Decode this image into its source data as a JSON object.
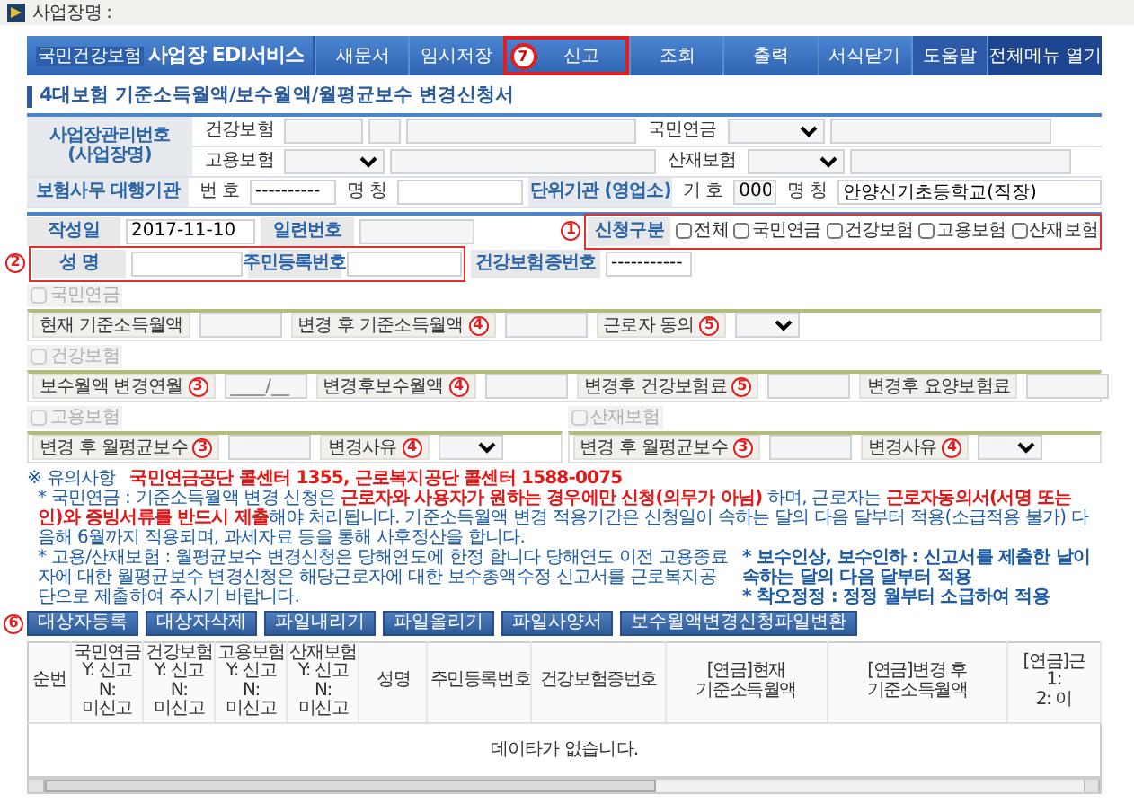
{
  "window": {
    "title": "사업장명 :"
  },
  "menu": {
    "logo": "국민건강보험",
    "service": "사업장 EDI서비스",
    "items": [
      {
        "label": "새문서",
        "kind": "main",
        "highlighted": false
      },
      {
        "label": "임시저장",
        "kind": "main",
        "highlighted": false
      },
      {
        "label": "신고",
        "kind": "main",
        "highlighted": true,
        "marker": "7"
      },
      {
        "label": "조회",
        "kind": "main",
        "highlighted": false
      },
      {
        "label": "출력",
        "kind": "main",
        "highlighted": false
      },
      {
        "label": "서식닫기",
        "kind": "main",
        "highlighted": false
      },
      {
        "label": "도움말",
        "kind": "help",
        "highlighted": false
      },
      {
        "label": "전체메뉴 열기",
        "kind": "all",
        "highlighted": false
      }
    ]
  },
  "heading": "4대보험 기준소득월액/보수월액/월평균보수 변경신청서",
  "workplace": {
    "label": "사업장관리번호 (사업장명)",
    "health_label": "건강보험",
    "pension_label": "국민연금",
    "employment_label": "고용보험",
    "accident_label": "산재보험",
    "agency_label": "보험사무 대행기관",
    "agency_number_label": "번 호",
    "agency_number": "----------",
    "agency_name_label": "명 칭",
    "unit_label": "단위기관 (영업소)",
    "unit_code_label": "기 호",
    "unit_code": "000",
    "unit_name_label": "명 칭",
    "unit_name": "안양신기초등학교(직장)"
  },
  "application": {
    "date_label": "작성일",
    "date": "2017-11-10",
    "serial_label": "일련번호",
    "type_label": "신청구분",
    "type_marker": "1",
    "types": [
      {
        "label": "전체",
        "checked": false
      },
      {
        "label": "국민연금",
        "checked": false
      },
      {
        "label": "건강보험",
        "checked": false
      },
      {
        "label": "고용보험",
        "checked": false
      },
      {
        "label": "산재보험",
        "checked": false
      }
    ],
    "name_label": "성  명",
    "name_marker": "2",
    "rrn_label": "주민등록번호",
    "card_label": "건강보험증번호",
    "card_number": "-----------"
  },
  "groups": [
    {
      "kind": "full",
      "label": "국민연금",
      "checked": false,
      "disabled": true,
      "fields": [
        {
          "kind": "text",
          "label": "현재 기준소득월액"
        },
        {
          "kind": "text",
          "label": "변경 후 기준소득월액",
          "marker": "4"
        },
        {
          "kind": "select",
          "label": "근로자 동의",
          "marker": "5"
        }
      ]
    },
    {
      "kind": "full",
      "label": "건강보험",
      "checked": false,
      "disabled": true,
      "fields": [
        {
          "kind": "text",
          "label": "보수월액 변경연월",
          "marker": "3",
          "placeholder": "____/__"
        },
        {
          "kind": "text",
          "label": "변경후보수월액",
          "marker": "4"
        },
        {
          "kind": "text",
          "label": "변경후 건강보험료",
          "marker": "5"
        },
        {
          "kind": "text",
          "label": "변경후 요양보험료"
        }
      ]
    },
    {
      "kind": "half",
      "label": "고용보험",
      "checked": false,
      "disabled": true,
      "fields": [
        {
          "kind": "text",
          "label": "변경 후 월평균보수",
          "marker": "3"
        },
        {
          "kind": "select",
          "label": "변경사유",
          "marker": "4"
        }
      ]
    },
    {
      "kind": "half",
      "label": "산재보험",
      "checked": false,
      "disabled": true,
      "fields": [
        {
          "kind": "text",
          "label": "변경 후 월평균보수",
          "marker": "3"
        },
        {
          "kind": "select",
          "label": "변경사유",
          "marker": "4"
        }
      ]
    }
  ],
  "notice": {
    "title": "※ 유의사항",
    "contact": "국민연금공단 콜센터 1355, 근로복지공단 콜센터 1588-0075",
    "items": [
      "* 국민연금 : 기준소득월액 변경 신청은 **근로자와 사용자가 원하는 경우에만 신청(의무가 아님)** 하며, 근로자는 **근로자동의서(서명 또는 인)와 증빙서류를 반드시 제출**해야 처리됩니다. 기준소득월액 변경 적용기간은 신청일이 속하는 달의 다음 달부터 적용(소급적용 불가) 다음해 6월까지 적용되며, 과세자료 등을 통해 사후정산을 합니다.",
      "* 고용/산재보험 : 월평균보수 변경신청은 당해연도에 한정 합니다 당해연도 이전 고용종료자에 대한 월평균보수 변경신청은 해당근로자에 대한 보수총액수정 신고서를 근로복지공단으로 제출하여 주시기 바랍니다."
    ],
    "side_notes": [
      "* 보수인상, 보수인하 : 신고서를 제출한 날이 속하는 달의 다음 달부터 적용",
      "* 착오정정 : 정정 월부터 소급하여 적용"
    ]
  },
  "actions": {
    "marker": "6",
    "buttons": [
      "대상자등록",
      "대상자삭제",
      "파일내리기",
      "파일올리기",
      "파일사양서",
      "보수월액변경신청파일변환"
    ]
  },
  "table": {
    "columns": [
      {
        "lines": [
          "순번"
        ]
      },
      {
        "lines": [
          "국민연금",
          "Y: 신고",
          "N: 미신고"
        ]
      },
      {
        "lines": [
          "건강보험",
          "Y: 신고",
          "N: 미신고"
        ]
      },
      {
        "lines": [
          "고용보험",
          "Y: 신고",
          "N: 미신고"
        ]
      },
      {
        "lines": [
          "산재보험",
          "Y: 신고",
          "N: 미신고"
        ]
      },
      {
        "lines": [
          "성명"
        ]
      },
      {
        "lines": [
          "주민등록번호"
        ]
      },
      {
        "lines": [
          "건강보험증번호"
        ]
      },
      {
        "lines": [
          "[연금]현재 기준소득월액"
        ]
      },
      {
        "lines": [
          "[연금]변경 후 기준소득월액"
        ]
      },
      {
        "lines": [
          "[연금]근",
          "1:",
          "2: 이"
        ]
      }
    ],
    "empty_message": "데이타가 없습니다."
  }
}
